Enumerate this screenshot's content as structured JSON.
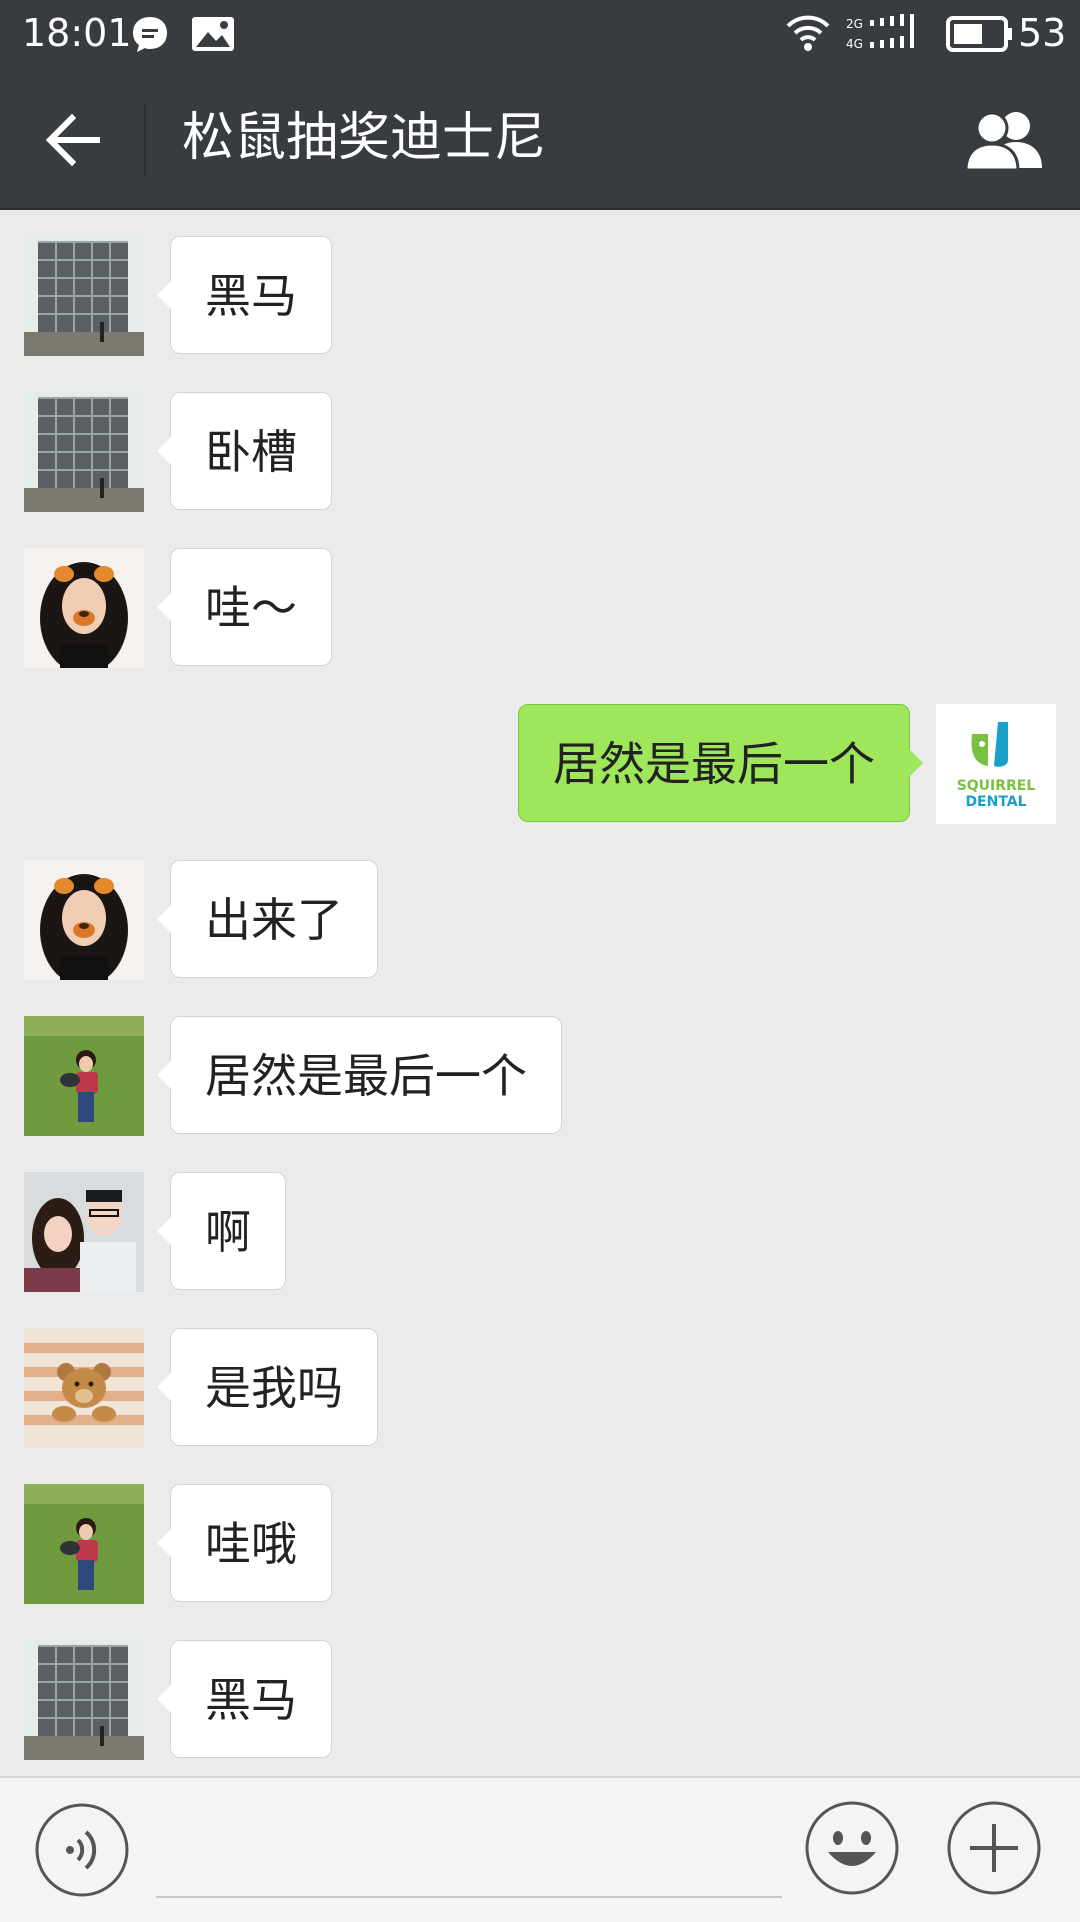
{
  "status_bar": {
    "time": "18:01",
    "battery": "53",
    "network": [
      "2G",
      "4G"
    ]
  },
  "title_bar": {
    "title": "松鼠抽奖迪士尼"
  },
  "messages": [
    {
      "side": "left",
      "avatar": "building-photo",
      "text": "黑马"
    },
    {
      "side": "left",
      "avatar": "building-photo",
      "text": "卧槽"
    },
    {
      "side": "left",
      "avatar": "girl-dog-filter-photo",
      "text": "哇～"
    },
    {
      "side": "right",
      "avatar": "squirrel-dental-logo",
      "text": "居然是最后一个"
    },
    {
      "side": "left",
      "avatar": "girl-dog-filter-photo",
      "text": "出来了"
    },
    {
      "side": "left",
      "avatar": "child-on-grass-photo",
      "text": "居然是最后一个"
    },
    {
      "side": "left",
      "avatar": "couple-selfie-photo",
      "text": "啊"
    },
    {
      "side": "left",
      "avatar": "teddy-bear-photo",
      "text": "是我吗"
    },
    {
      "side": "left",
      "avatar": "child-on-grass-photo",
      "text": "哇哦"
    },
    {
      "side": "left",
      "avatar": "building-photo",
      "text": "黑马"
    }
  ],
  "logo_text": {
    "line1": "SQUIRREL",
    "line2": "DENTAL"
  },
  "colors": {
    "header": "#383b40",
    "background": "#ebebeb",
    "sent_bubble": "#9ee75a",
    "received_bubble": "#ffffff"
  },
  "icons": {
    "back": "arrow-left-icon",
    "members": "people-icon",
    "voice": "voice-icon",
    "emoji": "smiley-icon",
    "more": "plus-icon"
  }
}
